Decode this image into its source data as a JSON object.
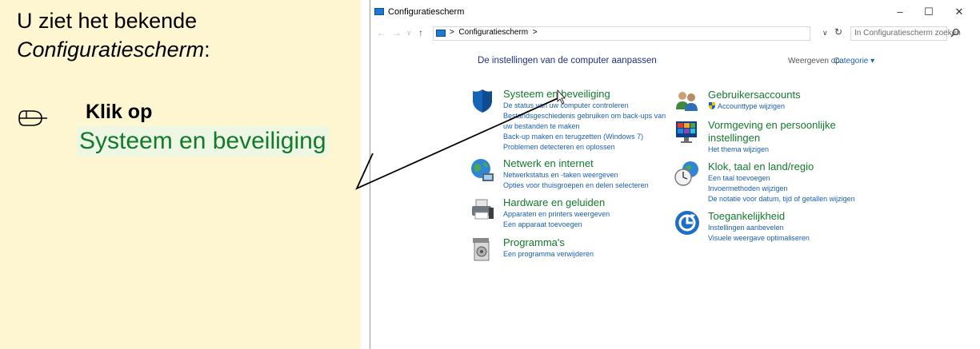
{
  "instruction": {
    "intro_line1": "U ziet het bekende",
    "intro_italic": "Configuratiescherm",
    "intro_colon": ":",
    "step_label": "Klik op",
    "target_label": "Systeem en beveiliging"
  },
  "window": {
    "title": "Configuratiescherm",
    "controls": {
      "minimize": "–",
      "maximize": "☐",
      "close": "✕"
    },
    "nav": {
      "back": "←",
      "forward": "→",
      "recent": "∨",
      "up": "↑"
    },
    "address": {
      "separator1": ">",
      "crumb": "Configuratiescherm",
      "separator2": ">"
    },
    "address_dropdown": "∨",
    "refresh": "↻",
    "search_placeholder": "In Configuratiescherm zoeken"
  },
  "main": {
    "heading": "De instellingen van de computer aanpassen",
    "view_by_label": "Weergeven op:",
    "view_by_value": "Categorie ▾",
    "categories": [
      {
        "title": "Systeem en beveiliging",
        "icon": "shield-icon",
        "links": [
          "De status van uw computer controleren",
          "Bestandsgeschiedenis gebruiken om back-ups van",
          "uw bestanden te maken",
          "Back-up maken en terugzetten (Windows 7)",
          "Problemen detecteren en oplossen"
        ]
      },
      {
        "title": "Netwerk en internet",
        "icon": "globe-icon",
        "links": [
          "Netwerkstatus en -taken weergeven",
          "Opties voor thuisgroepen en delen selecteren"
        ]
      },
      {
        "title": "Hardware en geluiden",
        "icon": "printer-icon",
        "links": [
          "Apparaten en printers weergeven",
          "Een apparaat toevoegen"
        ]
      },
      {
        "title": "Programma's",
        "icon": "programs-icon",
        "links": [
          "Een programma verwijderen"
        ]
      },
      {
        "title": "Gebruikersaccounts",
        "icon": "users-icon",
        "links": [
          "Accounttype wijzigen"
        ]
      },
      {
        "title_line1": "Vormgeving en persoonlijke",
        "title_line2": "instellingen",
        "icon": "appearance-icon",
        "links": [
          "Het thema wijzigen"
        ]
      },
      {
        "title": "Klok, taal en land/regio",
        "icon": "clock-globe-icon",
        "links": [
          "Een taal toevoegen",
          "Invoermethoden wijzigen",
          "De notatie voor datum, tijd of getallen wijzigen"
        ]
      },
      {
        "title": "Toegankelijkheid",
        "icon": "accessibility-icon",
        "links": [
          "Instellingen aanbevelen",
          "Visuele weergave optimaliseren"
        ]
      }
    ]
  },
  "colors": {
    "panel_bg": "#fdf6d0",
    "link_blue": "#1a5fb4",
    "category_green": "#137a2c",
    "heading_blue": "#1e3287"
  }
}
